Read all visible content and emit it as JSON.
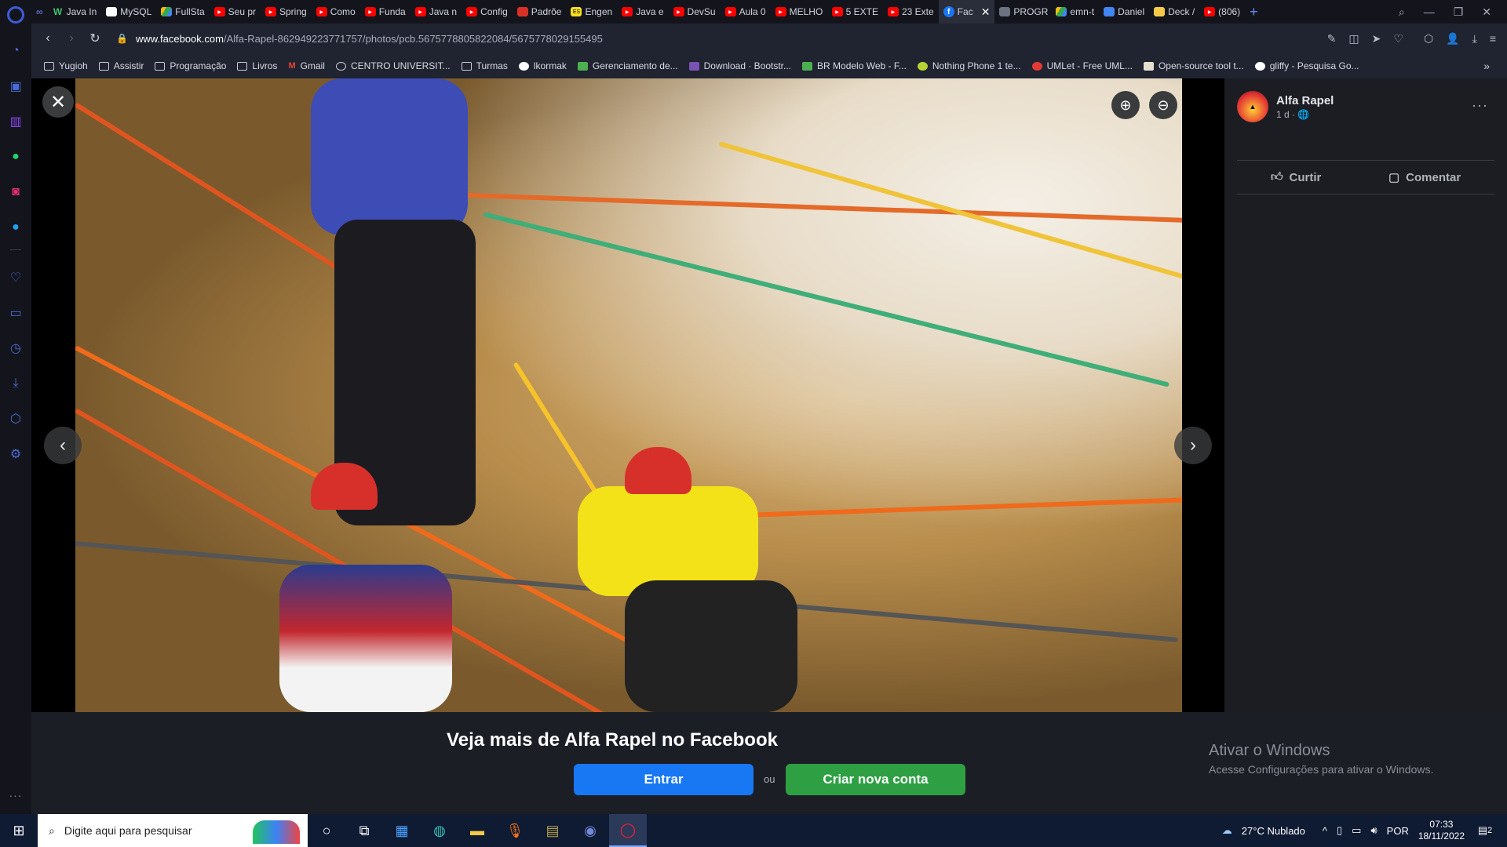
{
  "browser": {
    "tabs": [
      {
        "label": "Java In",
        "icon": "w"
      },
      {
        "label": "MySQL",
        "icon": "mysql"
      },
      {
        "label": "FullSta",
        "icon": "drive"
      },
      {
        "label": "Seu pr",
        "icon": "yt"
      },
      {
        "label": "Spring",
        "icon": "yt"
      },
      {
        "label": "Como",
        "icon": "yt"
      },
      {
        "label": "Funda",
        "icon": "yt"
      },
      {
        "label": "Java n",
        "icon": "yt"
      },
      {
        "label": "Config",
        "icon": "yt"
      },
      {
        "label": "Padrõe",
        "icon": "pdf"
      },
      {
        "label": "Engen",
        "icon": "es"
      },
      {
        "label": "Java e",
        "icon": "yt"
      },
      {
        "label": "DevSu",
        "icon": "yt"
      },
      {
        "label": "Aula 0",
        "icon": "yt"
      },
      {
        "label": "MELHO",
        "icon": "yt"
      },
      {
        "label": "5 EXTE",
        "icon": "yt"
      },
      {
        "label": "23 Exte",
        "icon": "yt"
      },
      {
        "label": "Fac",
        "icon": "fb",
        "active": true
      },
      {
        "label": "PROGR",
        "icon": "img"
      },
      {
        "label": "emn-t",
        "icon": "drive"
      },
      {
        "label": "Daniel",
        "icon": "doc"
      },
      {
        "label": "Deck /",
        "icon": "deck"
      },
      {
        "label": "(806)",
        "icon": "yt"
      }
    ],
    "address": {
      "domain": "www.facebook.com",
      "path": "/Alfa-Rapel-862949223771757/photos/pcb.5675778805822084/5675778029155495"
    },
    "bookmarks": [
      {
        "label": "Yugioh",
        "icon": "folder"
      },
      {
        "label": "Assistir",
        "icon": "folder"
      },
      {
        "label": "Programação",
        "icon": "folder"
      },
      {
        "label": "Livros",
        "icon": "folder"
      },
      {
        "label": "Gmail",
        "icon": "gmail"
      },
      {
        "label": "CENTRO UNIVERSIT...",
        "icon": "circle"
      },
      {
        "label": "Turmas",
        "icon": "folder"
      },
      {
        "label": "lkormak",
        "icon": "github"
      },
      {
        "label": "Gerenciamento de...",
        "icon": "br"
      },
      {
        "label": "Download · Bootstr...",
        "icon": "bootstrap"
      },
      {
        "label": "BR Modelo Web - F...",
        "icon": "br"
      },
      {
        "label": "Nothing Phone 1 te...",
        "icon": "nothing"
      },
      {
        "label": "UMLet - Free UML...",
        "icon": "umlet"
      },
      {
        "label": "Open-source tool t...",
        "icon": "os"
      },
      {
        "label": "gliffy - Pesquisa Go...",
        "icon": "google"
      }
    ]
  },
  "post": {
    "author": "Alfa Rapel",
    "meta": "1 d · ",
    "like_label": "Curtir",
    "comment_label": "Comentar"
  },
  "login_prompt": {
    "title": "Veja mais de Alfa Rapel no Facebook",
    "login_label": "Entrar",
    "or_label": "ou",
    "signup_label": "Criar nova conta"
  },
  "watermark": {
    "line1": "Ativar o Windows",
    "line2": "Acesse Configurações para ativar o Windows."
  },
  "taskbar": {
    "search_placeholder": "Digite aqui para pesquisar",
    "weather": "27°C  Nublado",
    "language": "POR",
    "time": "07:33",
    "date": "18/11/2022",
    "notification_count": "2"
  },
  "colors": {
    "facebook_blue": "#1877f2",
    "signup_green": "#2ea043"
  }
}
